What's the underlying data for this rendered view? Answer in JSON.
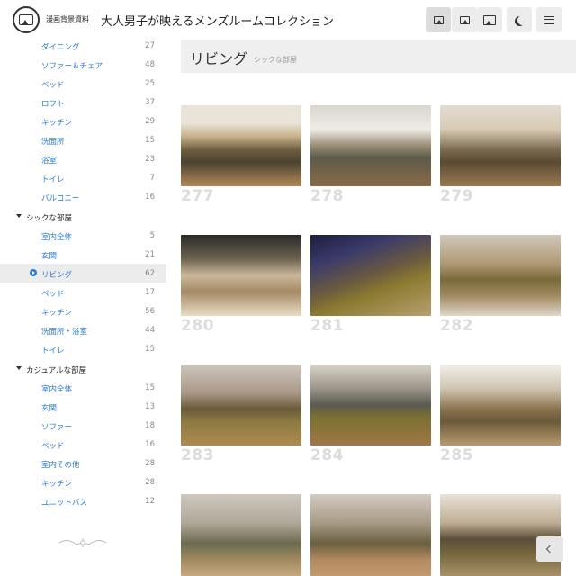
{
  "header": {
    "site_name": "漫画背景資料",
    "page_title": "大人男子が映えるメンズルームコレクション",
    "buttons": [
      "small-image-view-icon",
      "medium-image-view-icon",
      "large-image-view-icon",
      "dark-mode-icon",
      "menu-icon"
    ]
  },
  "sidebar": {
    "items": [
      {
        "label": "ダイニング",
        "count": "27"
      },
      {
        "label": "ソファー＆チェア",
        "count": "48"
      },
      {
        "label": "ベッド",
        "count": "25"
      },
      {
        "label": "ロフト",
        "count": "37"
      },
      {
        "label": "キッチン",
        "count": "29"
      },
      {
        "label": "洗面所",
        "count": "15"
      },
      {
        "label": "浴室",
        "count": "23"
      },
      {
        "label": "トイレ",
        "count": "7"
      },
      {
        "label": "バルコニー",
        "count": "16"
      }
    ],
    "group2": {
      "label": "シックな部屋",
      "items": [
        {
          "label": "室内全体",
          "count": "5"
        },
        {
          "label": "玄関",
          "count": "21"
        },
        {
          "label": "リビング",
          "count": "62"
        },
        {
          "label": "ベッド",
          "count": "17"
        },
        {
          "label": "キッチン",
          "count": "56"
        },
        {
          "label": "洗面所・浴室",
          "count": "44"
        },
        {
          "label": "トイレ",
          "count": "15"
        }
      ]
    },
    "group3": {
      "label": "カジュアルな部屋",
      "items": [
        {
          "label": "室内全体",
          "count": "15"
        },
        {
          "label": "玄関",
          "count": "13"
        },
        {
          "label": "ソファー",
          "count": "18"
        },
        {
          "label": "ベッド",
          "count": "16"
        },
        {
          "label": "室内その他",
          "count": "28"
        },
        {
          "label": "キッチン",
          "count": "28"
        },
        {
          "label": "ユニットバス",
          "count": "12"
        }
      ]
    }
  },
  "main": {
    "title": "リビング",
    "subtitle": "シックな部屋",
    "thumbnails": [
      {
        "number": "277"
      },
      {
        "number": "278"
      },
      {
        "number": "279"
      },
      {
        "number": "280"
      },
      {
        "number": "281"
      },
      {
        "number": "282"
      },
      {
        "number": "283"
      },
      {
        "number": "284"
      },
      {
        "number": "285"
      },
      {
        "number": ""
      },
      {
        "number": ""
      },
      {
        "number": ""
      }
    ]
  },
  "colors": {
    "link": "#2a7ad1",
    "count": "#888888",
    "number": "#dcdcdc",
    "titlebar": "#efefef"
  }
}
